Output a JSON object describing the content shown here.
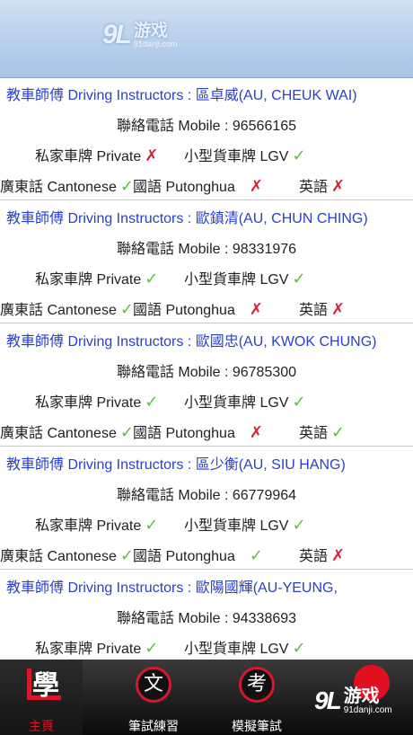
{
  "header": {
    "logo_num": "9L",
    "logo_cn": "游戏",
    "logo_site": "91danji.com"
  },
  "instructors": [
    {
      "title": "教車師傅 Driving Instructors : 區卓威(AU, CHEUK WAI)",
      "mobile": "聯絡電話 Mobile : 96566165",
      "private_label": "私家車牌 Private",
      "private": "no",
      "lgv_label": "小型貨車牌 LGV",
      "lgv": "ok",
      "cantonese_label": "廣東話 Cantonese",
      "cantonese": "ok",
      "putonghua_label": "國語 Putonghua",
      "putonghua": "no",
      "english_label": "英語",
      "english": "no"
    },
    {
      "title": "教車師傅 Driving Instructors : 歐鎮清(AU, CHUN CHING)",
      "mobile": "聯絡電話 Mobile : 98331976",
      "private_label": "私家車牌 Private",
      "private": "ok",
      "lgv_label": "小型貨車牌 LGV",
      "lgv": "ok",
      "cantonese_label": "廣東話 Cantonese",
      "cantonese": "ok",
      "putonghua_label": "國語 Putonghua",
      "putonghua": "no",
      "english_label": "英語",
      "english": "no"
    },
    {
      "title": "教車師傅 Driving Instructors : 歐國忠(AU, KWOK CHUNG)",
      "mobile": "聯絡電話 Mobile : 96785300",
      "private_label": "私家車牌 Private",
      "private": "ok",
      "lgv_label": "小型貨車牌 LGV",
      "lgv": "ok",
      "cantonese_label": "廣東話 Cantonese",
      "cantonese": "ok",
      "putonghua_label": "國語 Putonghua",
      "putonghua": "no",
      "english_label": "英語",
      "english": "ok"
    },
    {
      "title": "教車師傅 Driving Instructors : 區少衡(AU, SIU HANG)",
      "mobile": "聯絡電話 Mobile : 66779964",
      "private_label": "私家車牌 Private",
      "private": "ok",
      "lgv_label": "小型貨車牌 LGV",
      "lgv": "ok",
      "cantonese_label": "廣東話 Cantonese",
      "cantonese": "ok",
      "putonghua_label": "國語 Putonghua",
      "putonghua": "ok",
      "english_label": "英語",
      "english": "no"
    },
    {
      "title": "教車師傅 Driving Instructors : 歐陽國輝(AU-YEUNG,",
      "mobile": "聯絡電話 Mobile : 94338693",
      "private_label": "私家車牌 Private",
      "private": "ok",
      "lgv_label": "小型貨車牌 LGV",
      "lgv": "ok"
    }
  ],
  "marks": {
    "ok": "✓",
    "no": "✗"
  },
  "colors": {
    "ok": "#58c23a",
    "no": "#d4243a",
    "title": "#2a3fd0",
    "accent": "#d5182b"
  },
  "tabs": [
    {
      "label": "主頁",
      "icon_char": "學",
      "active": true
    },
    {
      "label": "筆試練習",
      "icon_char": "文",
      "active": false
    },
    {
      "label": "模擬筆試",
      "icon_char": "考",
      "active": false
    }
  ],
  "watermark": {
    "num": "9L",
    "cn": "游戏",
    "site": "91danji.com"
  }
}
